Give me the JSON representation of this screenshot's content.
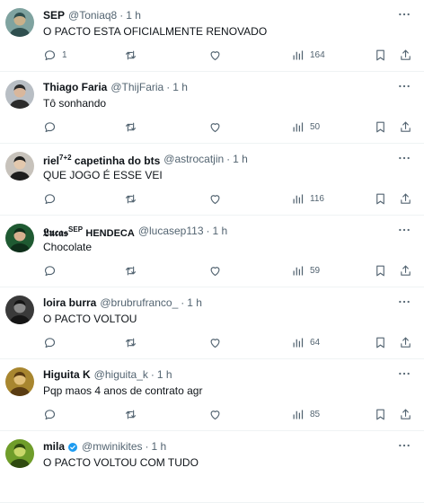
{
  "tweets": [
    {
      "name": "SEP",
      "name_sup": "",
      "name_sc": "",
      "handle": "@Toniaq8",
      "time": "1 h",
      "verified": false,
      "text": "O PACTO ESTA OFICIALMENTE RENOVADO",
      "replies": "1",
      "views": "164",
      "avatar": {
        "bg": "#7fa3a0",
        "fg": "#c9b08a",
        "accent": "#2f4f4f"
      }
    },
    {
      "name": "Thiago Faria",
      "name_sup": "",
      "name_sc": "",
      "handle": "@ThijFaria",
      "time": "1 h",
      "verified": false,
      "text": "Tô sonhando",
      "replies": "",
      "views": "50",
      "avatar": {
        "bg": "#b8bec4",
        "fg": "#d9b79c",
        "accent": "#2b2b2b"
      }
    },
    {
      "name": "riel",
      "name_sup": "7+2",
      "name_rest": " capetinha do bts",
      "name_sc": "",
      "handle": "@astrocatjin",
      "time": "1 h",
      "verified": false,
      "text": "QUE JOGO É ESSE VEI",
      "replies": "",
      "views": "116",
      "avatar": {
        "bg": "#c7c2bb",
        "fg": "#e3c8ad",
        "accent": "#1d1d1d"
      }
    },
    {
      "name": "𝕷𝖚𝖈𝖆𝖘",
      "name_sup": "SEP",
      "name_rest": "",
      "name_sc": "HENDECA",
      "handle": "@lucasep113",
      "time": "1 h",
      "verified": false,
      "text": "Chocolate",
      "replies": "",
      "views": "59",
      "avatar": {
        "bg": "#1f5a32",
        "fg": "#d6b08f",
        "accent": "#0e2e1a"
      }
    },
    {
      "name": "loira burra",
      "name_sup": "",
      "name_sc": "",
      "handle": "@brubrufranco_",
      "time": "1 h",
      "verified": false,
      "text": "O PACTO VOLTOU",
      "replies": "",
      "views": "64",
      "avatar": {
        "bg": "#3a3a3a",
        "fg": "#8a8a8a",
        "accent": "#151515"
      }
    },
    {
      "name": "Higuita K",
      "name_sup": "",
      "name_sc": "",
      "handle": "@higuita_k",
      "time": "1 h",
      "verified": false,
      "text": "Pqp maos 4 anos de contrato agr",
      "replies": "",
      "views": "85",
      "avatar": {
        "bg": "#a8862f",
        "fg": "#e2c07a",
        "accent": "#5a3c12"
      }
    },
    {
      "name": "mila",
      "name_sup": "",
      "name_sc": "",
      "handle": "@mwinikites",
      "time": "1 h",
      "verified": true,
      "text": "O PACTO VOLTOU COM TUDO",
      "replies": "",
      "views": "",
      "avatar": {
        "bg": "#6f9d2a",
        "fg": "#c9d86a",
        "accent": "#2f4a10"
      }
    }
  ],
  "colors": {
    "text": "#0f1419",
    "muted": "#536471",
    "border": "#eff3f4",
    "verified": "#1d9bf0"
  },
  "icons": {
    "reply": "reply-icon",
    "retweet": "retweet-icon",
    "like": "like-icon",
    "views": "views-icon",
    "bookmark": "bookmark-icon",
    "share": "share-icon",
    "more": "more-icon",
    "verified": "verified-icon"
  }
}
